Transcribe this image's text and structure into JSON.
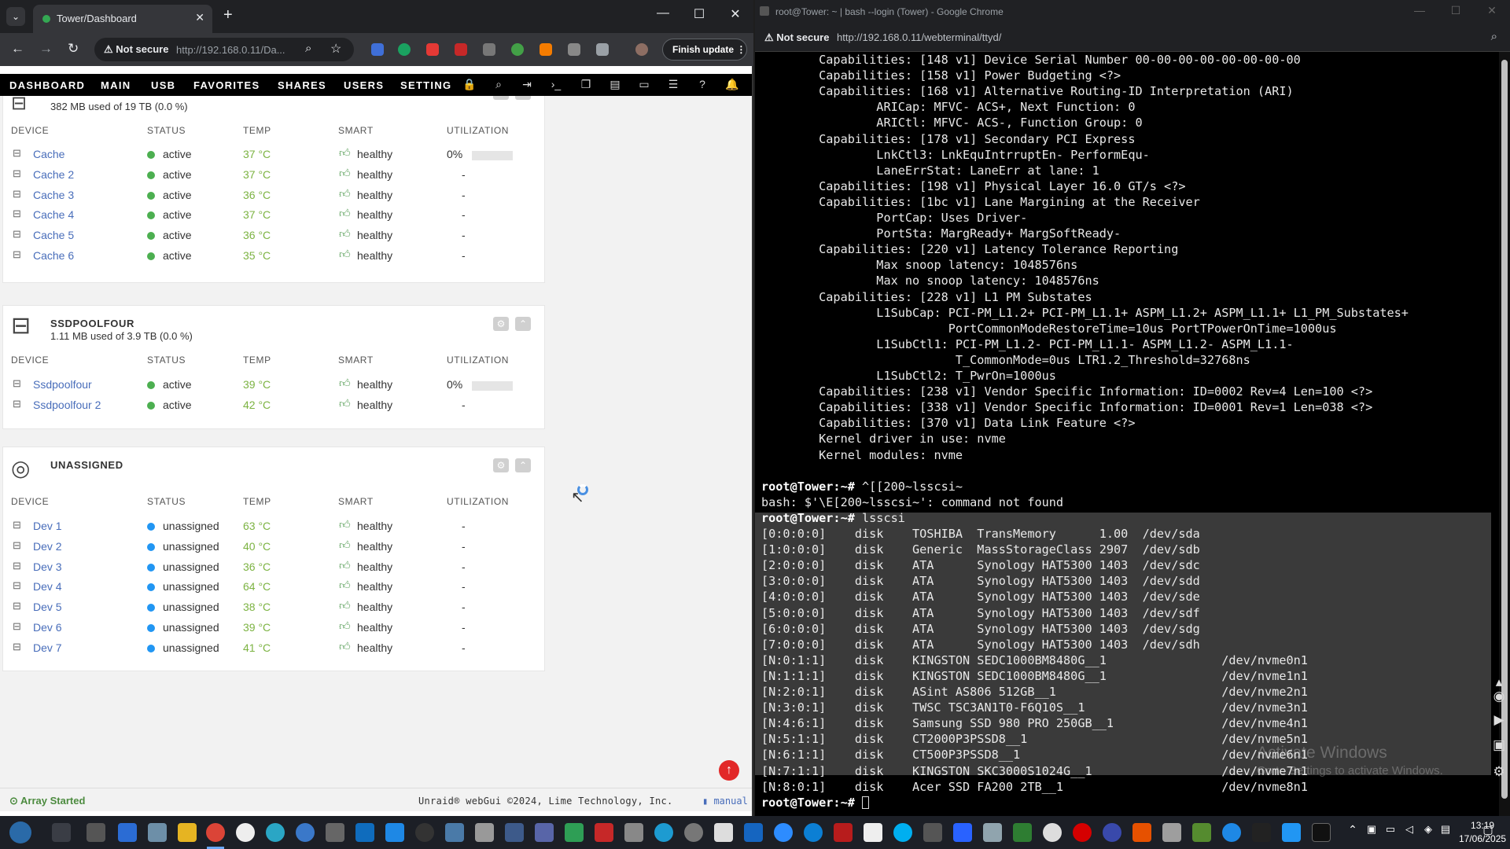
{
  "left_browser": {
    "tab_title": "Tower/Dashboard",
    "security_label": "Not secure",
    "url": "http://192.168.0.11/Da...",
    "finish_update_label": "Finish update"
  },
  "unraid_nav": {
    "items": [
      "DASHBOARD",
      "MAIN",
      "USB",
      "FAVORITES",
      "SHARES",
      "USERS",
      "SETTING"
    ]
  },
  "cache_panel": {
    "subtitle": "382 MB used of 19 TB (0.0 %)",
    "headers": [
      "DEVICE",
      "STATUS",
      "TEMP",
      "SMART",
      "UTILIZATION"
    ],
    "rows": [
      {
        "name": "Cache",
        "status": "active",
        "temp": "37 °C",
        "smart": "healthy",
        "util": "0%"
      },
      {
        "name": "Cache 2",
        "status": "active",
        "temp": "37 °C",
        "smart": "healthy",
        "util": "-"
      },
      {
        "name": "Cache 3",
        "status": "active",
        "temp": "36 °C",
        "smart": "healthy",
        "util": "-"
      },
      {
        "name": "Cache 4",
        "status": "active",
        "temp": "37 °C",
        "smart": "healthy",
        "util": "-"
      },
      {
        "name": "Cache 5",
        "status": "active",
        "temp": "36 °C",
        "smart": "healthy",
        "util": "-"
      },
      {
        "name": "Cache 6",
        "status": "active",
        "temp": "35 °C",
        "smart": "healthy",
        "util": "-"
      }
    ]
  },
  "ssdpool_panel": {
    "title": "SSDPOOLFOUR",
    "subtitle": "1.11 MB used of 3.9 TB (0.0 %)",
    "headers": [
      "DEVICE",
      "STATUS",
      "TEMP",
      "SMART",
      "UTILIZATION"
    ],
    "rows": [
      {
        "name": "Ssdpoolfour",
        "status": "active",
        "temp": "39 °C",
        "smart": "healthy",
        "util": "0%"
      },
      {
        "name": "Ssdpoolfour 2",
        "status": "active",
        "temp": "42 °C",
        "smart": "healthy",
        "util": "-"
      }
    ]
  },
  "unassigned_panel": {
    "title": "UNASSIGNED",
    "headers": [
      "DEVICE",
      "STATUS",
      "TEMP",
      "SMART",
      "UTILIZATION"
    ],
    "rows": [
      {
        "name": "Dev 1",
        "status": "unassigned",
        "temp": "63 °C",
        "smart": "healthy",
        "util": "-"
      },
      {
        "name": "Dev 2",
        "status": "unassigned",
        "temp": "40 °C",
        "smart": "healthy",
        "util": "-"
      },
      {
        "name": "Dev 3",
        "status": "unassigned",
        "temp": "36 °C",
        "smart": "healthy",
        "util": "-"
      },
      {
        "name": "Dev 4",
        "status": "unassigned",
        "temp": "64 °C",
        "smart": "healthy",
        "util": "-"
      },
      {
        "name": "Dev 5",
        "status": "unassigned",
        "temp": "38 °C",
        "smart": "healthy",
        "util": "-"
      },
      {
        "name": "Dev 6",
        "status": "unassigned",
        "temp": "39 °C",
        "smart": "healthy",
        "util": "-"
      },
      {
        "name": "Dev 7",
        "status": "unassigned",
        "temp": "41 °C",
        "smart": "healthy",
        "util": "-"
      }
    ]
  },
  "footer": {
    "array_status": "Array Started",
    "copyright": "Unraid® webGui ©2024, Lime Technology, Inc.",
    "manual_label": "manual"
  },
  "right_browser": {
    "window_title": "root@Tower: ~ | bash --login (Tower) - Google Chrome",
    "security_label": "Not secure",
    "url": "http://192.168.0.11/webterminal/ttyd/"
  },
  "terminal": {
    "lines": [
      "        Capabilities: [148 v1] Device Serial Number 00-00-00-00-00-00-00-00",
      "        Capabilities: [158 v1] Power Budgeting <?>",
      "        Capabilities: [168 v1] Alternative Routing-ID Interpretation (ARI)",
      "                ARICap: MFVC- ACS+, Next Function: 0",
      "                ARICtl: MFVC- ACS-, Function Group: 0",
      "        Capabilities: [178 v1] Secondary PCI Express",
      "                LnkCtl3: LnkEquIntrruptEn- PerformEqu-",
      "                LaneErrStat: LaneErr at lane: 1",
      "        Capabilities: [198 v1] Physical Layer 16.0 GT/s <?>",
      "        Capabilities: [1bc v1] Lane Margining at the Receiver",
      "                PortCap: Uses Driver-",
      "                PortSta: MargReady+ MargSoftReady-",
      "        Capabilities: [220 v1] Latency Tolerance Reporting",
      "                Max snoop latency: 1048576ns",
      "                Max no snoop latency: 1048576ns",
      "        Capabilities: [228 v1] L1 PM Substates",
      "                L1SubCap: PCI-PM_L1.2+ PCI-PM_L1.1+ ASPM_L1.2+ ASPM_L1.1+ L1_PM_Substates+",
      "                          PortCommonModeRestoreTime=10us PortTPowerOnTime=1000us",
      "                L1SubCtl1: PCI-PM_L1.2- PCI-PM_L1.1- ASPM_L1.2- ASPM_L1.1-",
      "                           T_CommonMode=0us LTR1.2_Threshold=32768ns",
      "                L1SubCtl2: T_PwrOn=1000us",
      "        Capabilities: [238 v1] Vendor Specific Information: ID=0002 Rev=4 Len=100 <?>",
      "        Capabilities: [338 v1] Vendor Specific Information: ID=0001 Rev=1 Len=038 <?>",
      "        Capabilities: [370 v1] Data Link Feature <?>",
      "        Kernel driver in use: nvme",
      "        Kernel modules: nvme"
    ],
    "prompt": "root@Tower:~#",
    "cmd1": " ^[[200~lsscsi~",
    "error": "bash: $'\\E[200~lsscsi~': command not found",
    "cmd2": " lsscsi",
    "lsscsi": [
      "[0:0:0:0]    disk    TOSHIBA  TransMemory      1.00  /dev/sda",
      "[1:0:0:0]    disk    Generic  MassStorageClass 2907  /dev/sdb",
      "[2:0:0:0]    disk    ATA      Synology HAT5300 1403  /dev/sdc",
      "[3:0:0:0]    disk    ATA      Synology HAT5300 1403  /dev/sdd",
      "[4:0:0:0]    disk    ATA      Synology HAT5300 1403  /dev/sde",
      "[5:0:0:0]    disk    ATA      Synology HAT5300 1403  /dev/sdf",
      "[6:0:0:0]    disk    ATA      Synology HAT5300 1403  /dev/sdg",
      "[7:0:0:0]    disk    ATA      Synology HAT5300 1403  /dev/sdh",
      "[N:0:1:1]    disk    KINGSTON SEDC1000BM8480G__1                /dev/nvme0n1",
      "[N:1:1:1]    disk    KINGSTON SEDC1000BM8480G__1                /dev/nvme1n1",
      "[N:2:0:1]    disk    ASint AS806 512GB__1                       /dev/nvme2n1",
      "[N:3:0:1]    disk    TWSC TSC3AN1T0-F6Q10S__1                   /dev/nvme3n1",
      "[N:4:6:1]    disk    Samsung SSD 980 PRO 250GB__1               /dev/nvme4n1",
      "[N:5:1:1]    disk    CT2000P3PSSD8__1                           /dev/nvme5n1",
      "[N:6:1:1]    disk    CT500P3PSSD8__1                            /dev/nvme6n1",
      "[N:7:1:1]    disk    KINGSTON SKC3000S1024G__1                  /dev/nvme7n1",
      "[N:8:0:1]    disk    Acer SSD FA200 2TB__1                      /dev/nvme8n1"
    ]
  },
  "watermark": {
    "line1": "Activate Windows",
    "line2": "Go to Settings to activate Windows."
  },
  "taskbar": {
    "time": "13:19",
    "date": "17/06/2025"
  },
  "colors": {
    "active_dot": "#4caf50",
    "unassigned_dot": "#2196f3",
    "temp_green": "#7cb342"
  }
}
